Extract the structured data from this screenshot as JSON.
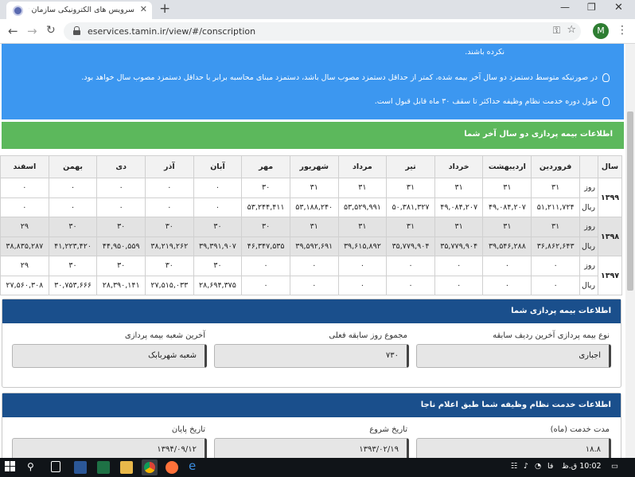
{
  "browser": {
    "tab_title": "سرویس های الکترونیکی سازمان تأ",
    "url": "eservices.tamin.ir/view/#/conscription",
    "avatar_initial": "M"
  },
  "notes": {
    "line0": "نکرده باشند.",
    "line1": "در صورتیکه متوسط دستمزد دو سال آخر بیمه شده، کمتر از حداقل دستمزد مصوب سال باشد، دستمزد مبنای محاسبه برابر با حداقل دستمزد مصوب سال خواهد بود.",
    "line2": "طول دوره خدمت نظام وظیفه حداکثر تا سقف ۳۰ ماه قابل قبول است."
  },
  "insurance_table": {
    "title": "اطلاعات بیمه پردازی دو سال آخر شما",
    "year_header": "سال",
    "months": [
      "فروردین",
      "اردیبهشت",
      "خرداد",
      "تیر",
      "مرداد",
      "شهریور",
      "مهر",
      "آبان",
      "آذر",
      "دی",
      "بهمن",
      "اسفند"
    ],
    "day_label": "روز",
    "rial_label": "ریال",
    "years": [
      {
        "year": "۱۳۹۹",
        "shaded": false,
        "days": [
          "۳۱",
          "۳۱",
          "۳۱",
          "۳۱",
          "۳۱",
          "۳۱",
          "۳۰",
          "۰",
          "۰",
          "۰",
          "۰",
          "۰"
        ],
        "rials": [
          "۵۱,۲۱۱,۷۲۴",
          "۴۹,۰۸۴,۲۰۷",
          "۴۹,۰۸۴,۲۰۷",
          "۵۰,۳۸۱,۳۲۷",
          "۵۳,۵۲۹,۹۹۱",
          "۵۳,۱۸۸,۲۴۰",
          "۵۳,۲۴۴,۴۱۱",
          "۰",
          "۰",
          "۰",
          "۰",
          "۰"
        ]
      },
      {
        "year": "۱۳۹۸",
        "shaded": true,
        "days": [
          "۳۱",
          "۳۱",
          "۳۱",
          "۳۱",
          "۳۱",
          "۳۱",
          "۳۰",
          "۳۰",
          "۳۰",
          "۳۰",
          "۳۰",
          "۲۹"
        ],
        "rials": [
          "۳۶,۸۶۲,۶۴۳",
          "۳۹,۵۴۶,۲۸۸",
          "۳۵,۷۷۹,۹۰۴",
          "۳۵,۷۷۹,۹۰۴",
          "۳۹,۶۱۵,۸۹۲",
          "۳۹,۵۹۲,۶۹۱",
          "۴۶,۳۴۷,۵۳۵",
          "۳۹,۳۹۱,۹۰۷",
          "۳۸,۲۱۹,۲۶۲",
          "۴۴,۹۵۰,۵۵۹",
          "۴۱,۲۲۳,۴۲۰",
          "۳۸,۸۳۵,۲۸۷"
        ]
      },
      {
        "year": "۱۳۹۷",
        "shaded": false,
        "days": [
          "۰",
          "۰",
          "۰",
          "۰",
          "۰",
          "۰",
          "۰",
          "۳۰",
          "۳۰",
          "۳۰",
          "۳۰",
          "۲۹"
        ],
        "rials": [
          "۰",
          "۰",
          "۰",
          "۰",
          "۰",
          "۰",
          "۰",
          "۲۸,۶۹۴,۳۷۵",
          "۲۷,۵۱۵,۰۳۳",
          "۲۸,۳۹۰,۱۴۱",
          "۳۰,۷۵۳,۶۶۶",
          "۲۷,۵۶۰,۳۰۸"
        ]
      }
    ]
  },
  "insurance_info": {
    "title": "اطلاعات بیمه پردازی شما",
    "type_label": "نوع بیمه پردازی آخرین ردیف سابقه",
    "type_value": "اجباری",
    "total_label": "مجموع روز سابقه فعلی",
    "total_value": "۷۳۰",
    "branch_label": "آخرین شعبه بیمه پردازی",
    "branch_value": "شعبه شهربابک"
  },
  "service_info": {
    "title": "اطلاعات خدمت نظام وظیفه شما طبق اعلام ناجا",
    "duration_label": "مدت خدمت (ماه)",
    "duration_value": "۱۸.۸",
    "start_label": "تاریخ شروع",
    "start_value": "۱۳۹۳/۰۲/۱۹",
    "end_label": "تاریخ پایان",
    "end_value": "۱۳۹۴/۰۹/۱۲"
  },
  "taskbar": {
    "lang": "فا",
    "time": "10:02 ق.ظ"
  }
}
